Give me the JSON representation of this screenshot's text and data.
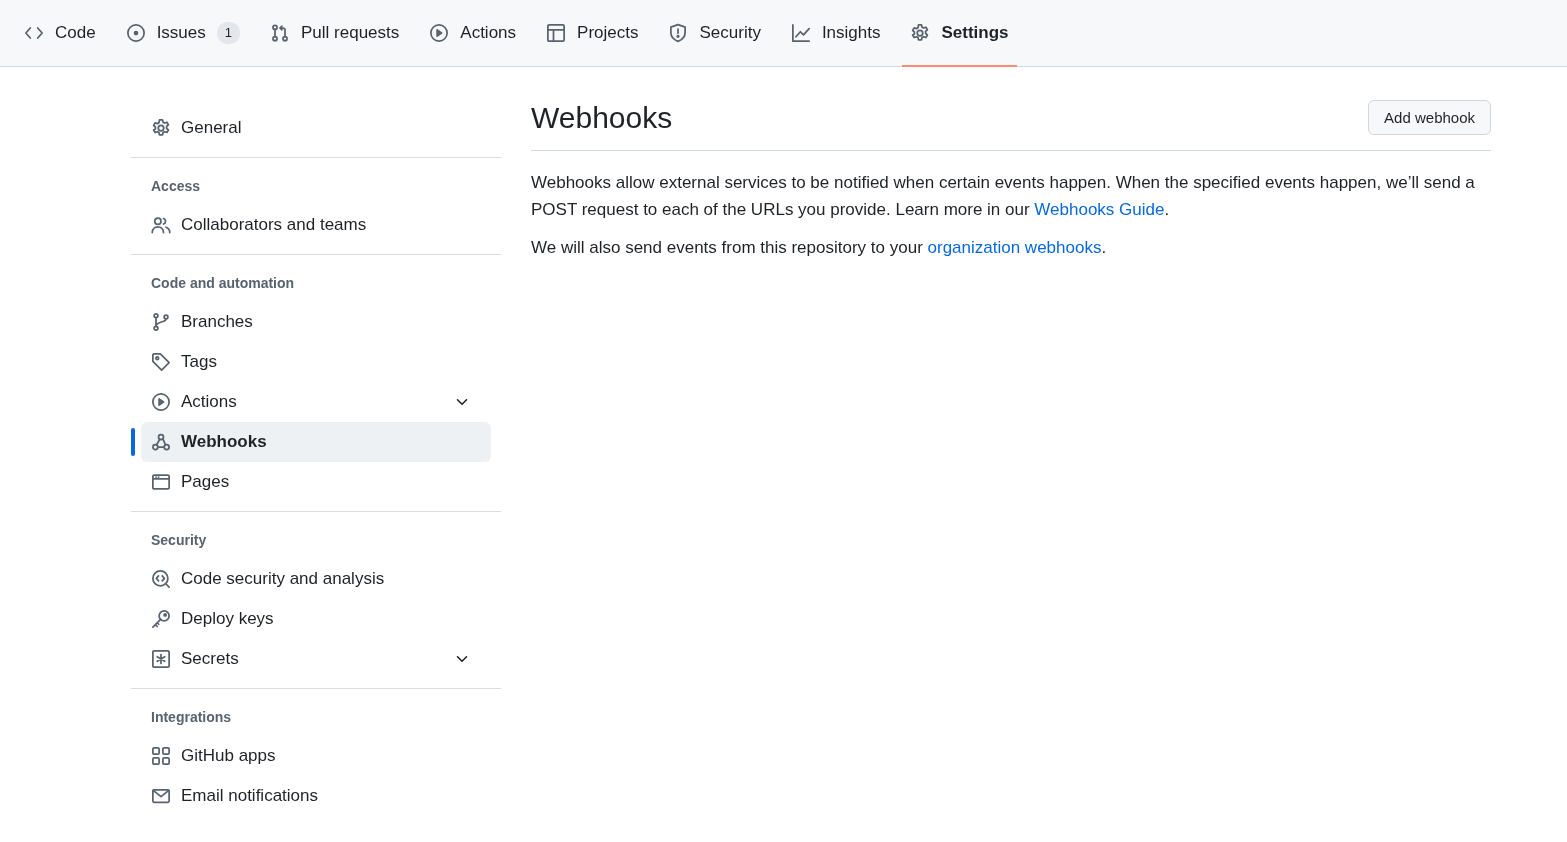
{
  "tabs": [
    {
      "label": "Code",
      "selected": false
    },
    {
      "label": "Issues",
      "counter": "1",
      "selected": false
    },
    {
      "label": "Pull requests",
      "selected": false
    },
    {
      "label": "Actions",
      "selected": false
    },
    {
      "label": "Projects",
      "selected": false
    },
    {
      "label": "Security",
      "selected": false
    },
    {
      "label": "Insights",
      "selected": false
    },
    {
      "label": "Settings",
      "selected": true
    }
  ],
  "sidebar": {
    "general": {
      "label": "General",
      "selected": false
    },
    "sections": [
      {
        "heading": "Access",
        "items": [
          {
            "label": "Collaborators and teams",
            "selected": false
          }
        ]
      },
      {
        "heading": "Code and automation",
        "items": [
          {
            "label": "Branches",
            "selected": false
          },
          {
            "label": "Tags",
            "selected": false
          },
          {
            "label": "Actions",
            "selected": false,
            "expanded": false
          },
          {
            "label": "Webhooks",
            "selected": true
          },
          {
            "label": "Pages",
            "selected": false
          }
        ]
      },
      {
        "heading": "Security",
        "items": [
          {
            "label": "Code security and analysis",
            "selected": false
          },
          {
            "label": "Deploy keys",
            "selected": false
          },
          {
            "label": "Secrets",
            "selected": false,
            "expanded": false
          }
        ]
      },
      {
        "heading": "Integrations",
        "items": [
          {
            "label": "GitHub apps",
            "selected": false
          },
          {
            "label": "Email notifications",
            "selected": false
          }
        ]
      }
    ]
  },
  "main": {
    "title": "Webhooks",
    "button": "Add webhook",
    "paragraphs": [
      [
        {
          "kind": "text",
          "text": "Webhooks allow external services to be notified when certain events happen. When the specified events happen, we’ll send a POST request to each of the URLs you provide. Learn more in our "
        },
        {
          "kind": "link",
          "text": "Webhooks Guide"
        },
        {
          "kind": "text",
          "text": "."
        }
      ],
      [
        {
          "kind": "text",
          "text": "We will also send events from this repository to your "
        },
        {
          "kind": "link",
          "text": "organization webhooks"
        },
        {
          "kind": "text",
          "text": "."
        }
      ]
    ]
  }
}
